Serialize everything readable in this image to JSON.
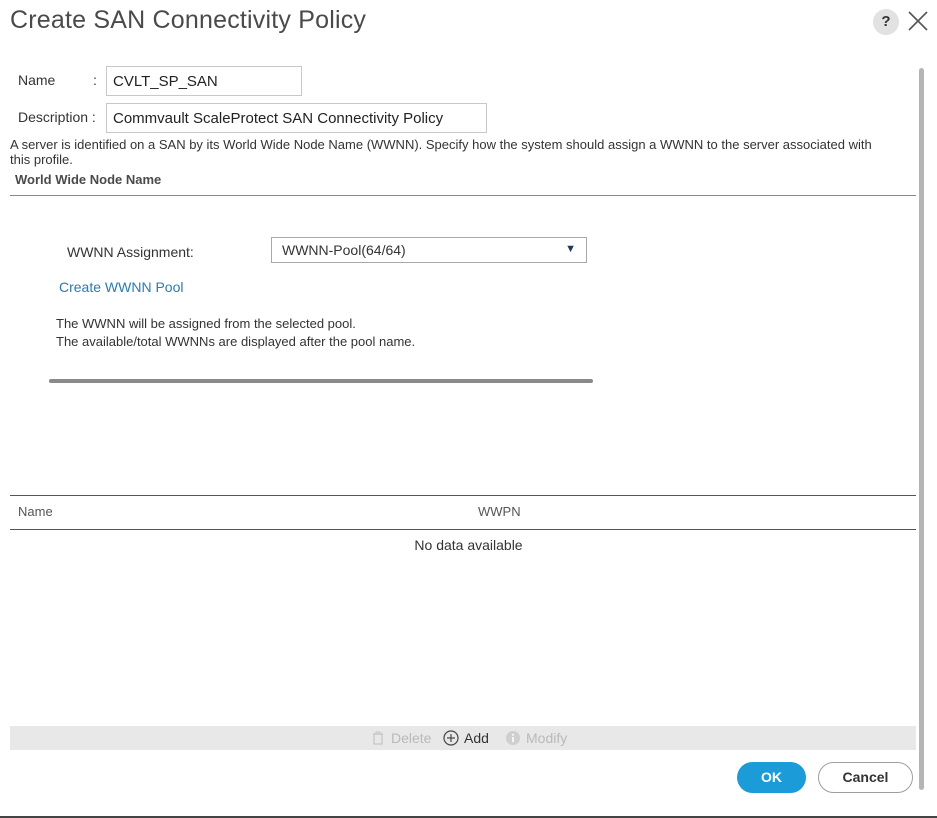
{
  "dialog": {
    "title": "Create SAN Connectivity Policy",
    "help_label": "?"
  },
  "form": {
    "name_label": "Name",
    "name_colon": ":",
    "name_value": "CVLT_SP_SAN",
    "description_label": "Description :",
    "description_value": "Commvault ScaleProtect SAN Connectivity Policy"
  },
  "intro_text": "A server is identified on a SAN by its World Wide Node Name (WWNN). Specify how the system should assign a WWNN to the server associated with this profile.",
  "wwnn_section": {
    "title": "World Wide Node Name",
    "assignment_label": "WWNN Assignment:",
    "assignment_value": "WWNN-Pool(64/64)",
    "create_pool_link": "Create WWNN Pool",
    "info_line_1": "The WWNN will be assigned from the selected pool.",
    "info_line_2": "The available/total WWNNs are displayed after the pool name."
  },
  "table": {
    "columns": [
      "Name",
      "WWPN"
    ],
    "empty_message": "No data available"
  },
  "toolbar": {
    "delete_label": "Delete",
    "add_label": "Add",
    "modify_label": "Modify"
  },
  "footer": {
    "ok_label": "OK",
    "cancel_label": "Cancel"
  },
  "colors": {
    "primary": "#1b9bd8",
    "link": "#2b7bb0"
  }
}
